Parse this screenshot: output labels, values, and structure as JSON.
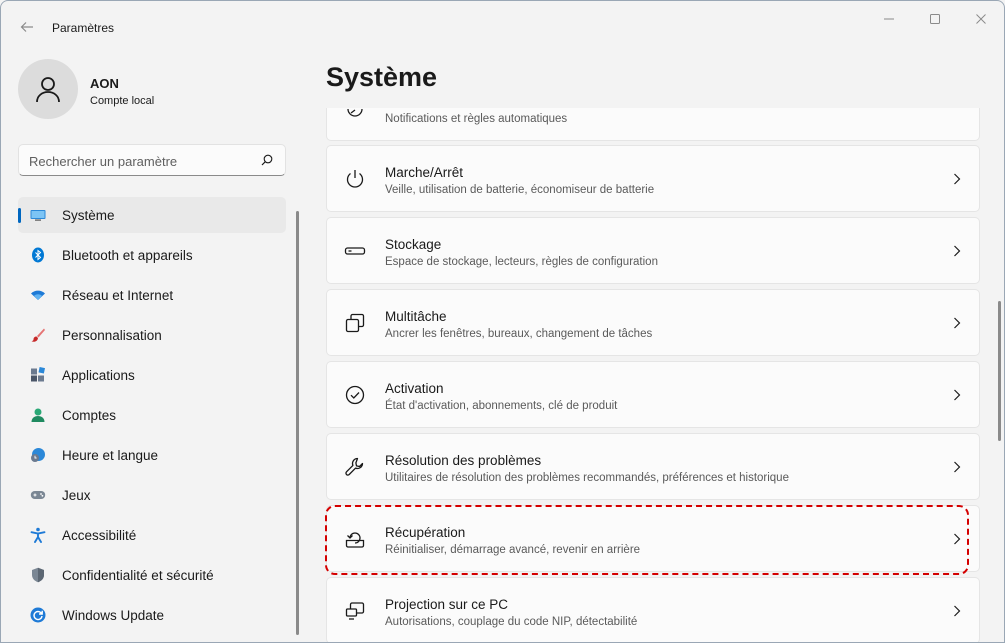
{
  "window": {
    "title": "Paramètres"
  },
  "profile": {
    "name": "AON",
    "account_type": "Compte local"
  },
  "search": {
    "placeholder": "Rechercher un paramètre"
  },
  "nav": {
    "items": [
      {
        "label": "Système",
        "icon": "monitor-icon",
        "active": true
      },
      {
        "label": "Bluetooth et appareils",
        "icon": "bluetooth-icon"
      },
      {
        "label": "Réseau et Internet",
        "icon": "wifi-icon"
      },
      {
        "label": "Personnalisation",
        "icon": "brush-icon"
      },
      {
        "label": "Applications",
        "icon": "apps-icon"
      },
      {
        "label": "Comptes",
        "icon": "person-icon"
      },
      {
        "label": "Heure et langue",
        "icon": "globe-clock-icon"
      },
      {
        "label": "Jeux",
        "icon": "gamepad-icon"
      },
      {
        "label": "Accessibilité",
        "icon": "accessibility-icon"
      },
      {
        "label": "Confidentialité et sécurité",
        "icon": "shield-icon"
      },
      {
        "label": "Windows Update",
        "icon": "update-icon"
      }
    ]
  },
  "main": {
    "title": "Système",
    "cards": [
      {
        "title": "",
        "subtitle": "Notifications et règles automatiques",
        "icon": "focus-icon"
      },
      {
        "title": "Marche/Arrêt",
        "subtitle": "Veille, utilisation de batterie, économiseur de batterie",
        "icon": "power-icon"
      },
      {
        "title": "Stockage",
        "subtitle": "Espace de stockage, lecteurs, règles de configuration",
        "icon": "storage-icon"
      },
      {
        "title": "Multitâche",
        "subtitle": "Ancrer les fenêtres, bureaux, changement de tâches",
        "icon": "multitask-icon"
      },
      {
        "title": "Activation",
        "subtitle": "État d'activation, abonnements, clé de produit",
        "icon": "check-circle-icon"
      },
      {
        "title": "Résolution des problèmes",
        "subtitle": "Utilitaires de résolution des problèmes recommandés, préférences et historique",
        "icon": "wrench-icon"
      },
      {
        "title": "Récupération",
        "subtitle": "Réinitialiser, démarrage avancé, revenir en arrière",
        "icon": "recovery-icon",
        "highlighted": true
      },
      {
        "title": "Projection sur ce PC",
        "subtitle": "Autorisations, couplage du code NIP, détectabilité",
        "icon": "projection-icon"
      }
    ]
  },
  "colors": {
    "accent": "#0067c0",
    "highlight": "#d40000",
    "background": "#f3f3f3",
    "card": "#fbfbfb"
  }
}
